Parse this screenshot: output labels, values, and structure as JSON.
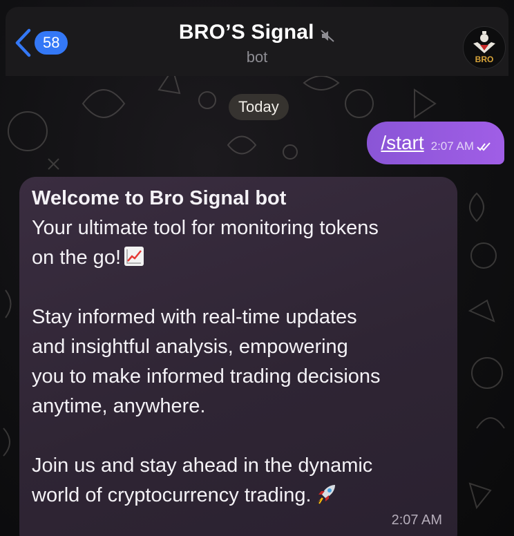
{
  "header": {
    "unread_count": "58",
    "title": "BRO’S Signal",
    "subtitle": "bot",
    "avatar_label": "BRO"
  },
  "date_separator": "Today",
  "messages": {
    "outgoing": {
      "text": "/start",
      "time": "2:07 AM"
    },
    "incoming": {
      "title": "Welcome to Bro Signal bot",
      "line1": "Your ultimate tool for monitoring tokens",
      "line2": "on the go!",
      "para2_line1": "Stay informed with real-time updates",
      "para2_line2": "and insightful analysis, empowering",
      "para2_line3": "you to make informed trading decisions",
      "para2_line4": "anytime, anywhere.",
      "para3_line1": "Join us and stay ahead in the dynamic",
      "para3_line2": "world of cryptocurrency trading.",
      "time": "2:07 AM"
    }
  },
  "icons": {
    "back": "chevron-left-icon",
    "mute": "muted-speaker-icon",
    "read_receipt": "double-check-icon",
    "emoji_chart": "chart-increasing-emoji",
    "emoji_rocket": "rocket-emoji"
  },
  "colors": {
    "accent_blue": "#3478f6",
    "outgoing_bubble": "#9a5be2",
    "incoming_bubble": "#33283a",
    "header_bg": "#1b1a1c"
  }
}
